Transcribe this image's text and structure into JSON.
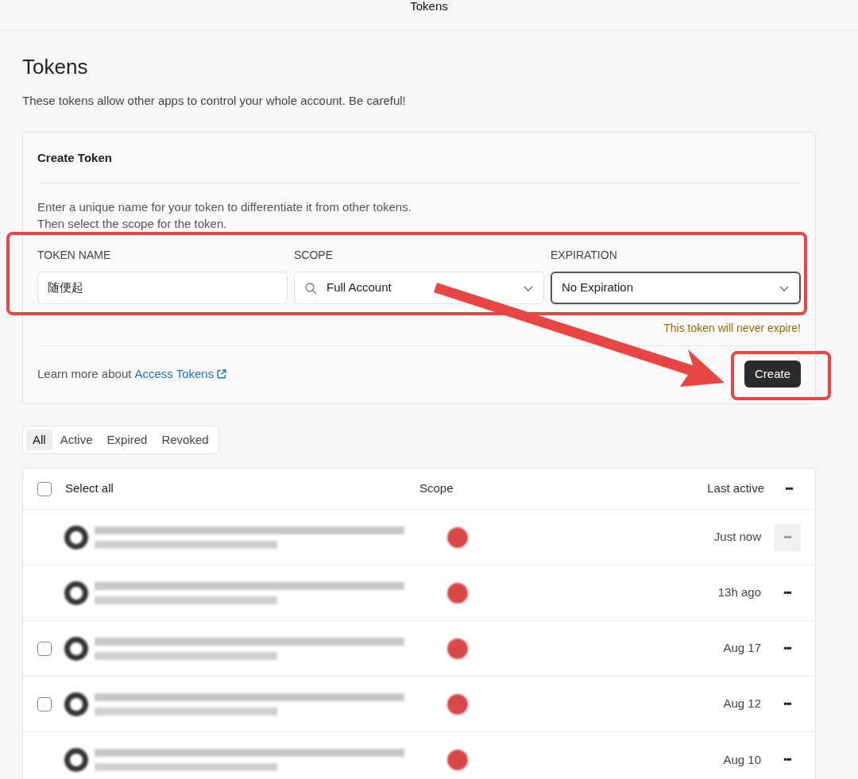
{
  "window": {
    "title": "Tokens"
  },
  "page": {
    "heading": "Tokens",
    "description": "These tokens allow other apps to control your whole account. Be careful!"
  },
  "create_token": {
    "title": "Create Token",
    "instructions": [
      "Enter a unique name for your token to differentiate it from other tokens.",
      "Then select the scope for the token."
    ],
    "fields": [
      {
        "kind": "text",
        "label": "TOKEN NAME",
        "value": "随便起",
        "focused": false
      },
      {
        "kind": "search-select",
        "label": "SCOPE",
        "value": "Full Account",
        "focused": false
      },
      {
        "kind": "select",
        "label": "EXPIRATION",
        "value": "No Expiration",
        "focused": true
      }
    ],
    "warning": "This token will never expire!",
    "learn_more": "Learn more about",
    "link": "Access Tokens",
    "button": "Create"
  },
  "filter_tabs": [
    {
      "label": "All",
      "selected": true
    },
    {
      "label": "Active",
      "selected": false
    },
    {
      "label": "Expired",
      "selected": false
    },
    {
      "label": "Revoked",
      "selected": false
    }
  ],
  "table": {
    "select_all": "Select all",
    "select_all_checked": false,
    "columns": [
      "Scope",
      "Last active"
    ],
    "more": "•••",
    "rows": [
      {
        "last_active": "Just now",
        "highlighted": true
      },
      {
        "last_active": "13h ago",
        "highlighted": false
      },
      {
        "checked": false,
        "last_active": "Aug 17",
        "highlighted": false
      },
      {
        "checked": false,
        "last_active": "Aug 12",
        "highlighted": false
      },
      {
        "last_active": "Aug 10",
        "highlighted": false
      }
    ]
  },
  "annotations": [
    {
      "kind": "box"
    },
    {
      "kind": "box"
    },
    {
      "kind": "arrow"
    }
  ]
}
